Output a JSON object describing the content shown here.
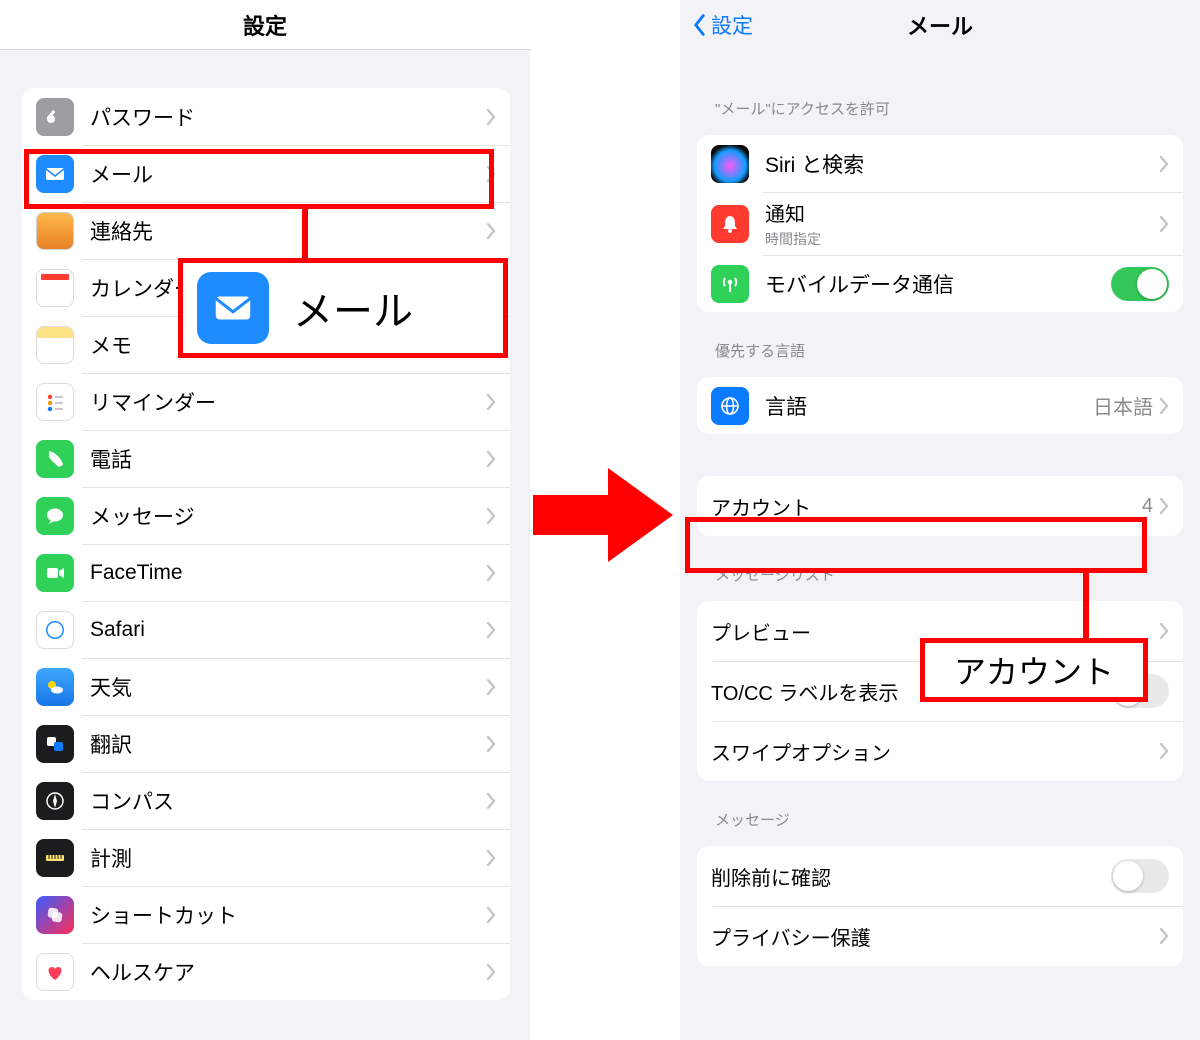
{
  "left": {
    "nav_title": "設定",
    "items": [
      {
        "key": "passwords",
        "label": "パスワード"
      },
      {
        "key": "mail",
        "label": "メール"
      },
      {
        "key": "contacts",
        "label": "連絡先"
      },
      {
        "key": "calendar",
        "label": "カレンダー"
      },
      {
        "key": "notes",
        "label": "メモ"
      },
      {
        "key": "reminders",
        "label": "リマインダー"
      },
      {
        "key": "phone",
        "label": "電話"
      },
      {
        "key": "messages",
        "label": "メッセージ"
      },
      {
        "key": "facetime",
        "label": "FaceTime"
      },
      {
        "key": "safari",
        "label": "Safari"
      },
      {
        "key": "weather",
        "label": "天気"
      },
      {
        "key": "translate",
        "label": "翻訳"
      },
      {
        "key": "compass",
        "label": "コンパス"
      },
      {
        "key": "measure",
        "label": "計測"
      },
      {
        "key": "shortcuts",
        "label": "ショートカット"
      },
      {
        "key": "health",
        "label": "ヘルスケア"
      }
    ],
    "callout_label": "メール"
  },
  "right": {
    "back_label": "設定",
    "nav_title": "メール",
    "section_access_header": "\"メール\"にアクセスを許可",
    "siri_label": "Siri と検索",
    "notif_label": "通知",
    "notif_sub": "時間指定",
    "cellular_label": "モバイルデータ通信",
    "cellular_on": true,
    "section_lang_header": "優先する言語",
    "language_label": "言語",
    "language_value": "日本語",
    "account_label": "アカウント",
    "account_value": "4",
    "section_msglist_header": "メッセージリスト",
    "preview_label": "プレビュー",
    "tocc_label": "TO/CC ラベルを表示",
    "tocc_on": false,
    "swipe_label": "スワイプオプション",
    "section_msg_header": "メッセージ",
    "confirm_label": "削除前に確認",
    "confirm_on": false,
    "privacy_label": "プライバシー保護",
    "callout_label": "アカウント"
  }
}
